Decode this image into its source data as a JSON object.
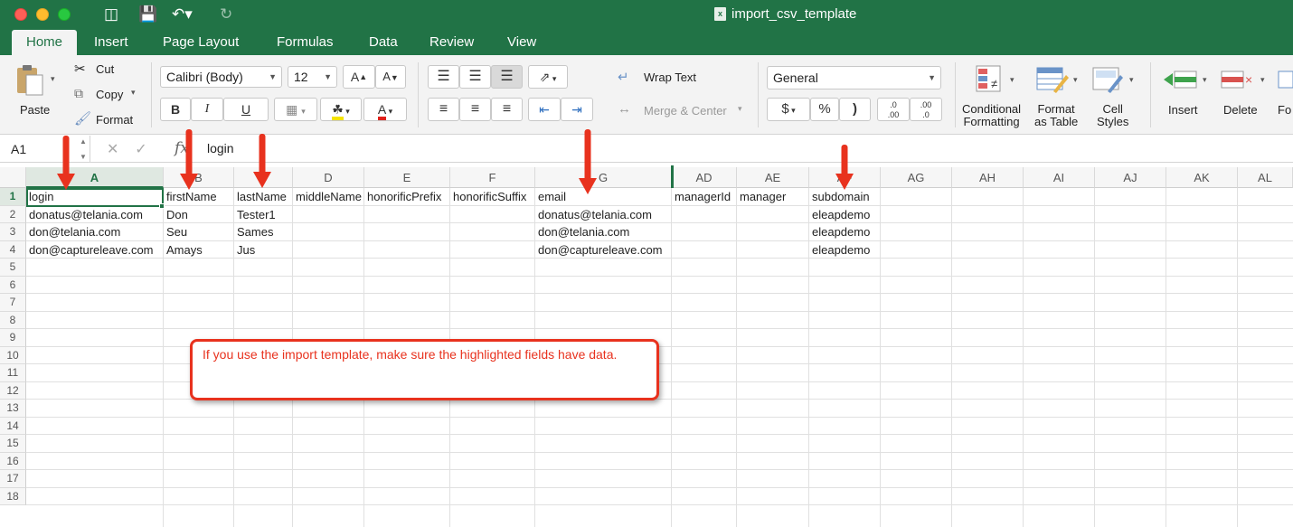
{
  "window": {
    "title": "import_csv_template"
  },
  "quick_access": {
    "icons": [
      "sidebar-icon",
      "save-icon",
      "undo-icon",
      "redo-icon"
    ]
  },
  "ribbon_tabs": [
    "Home",
    "Insert",
    "Page Layout",
    "Formulas",
    "Data",
    "Review",
    "View"
  ],
  "active_tab": "Home",
  "clipboard": {
    "paste": "Paste",
    "cut": "Cut",
    "copy": "Copy",
    "format": "Format"
  },
  "font": {
    "name": "Calibri (Body)",
    "size": "12",
    "bold": "B",
    "italic": "I",
    "underline": "U",
    "font_color_label": "A"
  },
  "alignment": {
    "wrap_text": "Wrap Text",
    "merge_center": "Merge & Center"
  },
  "number": {
    "format": "General",
    "currency": "$",
    "percent": "%",
    "comma": ")",
    "inc_decimal": ".0\n.00",
    "dec_decimal": ".00\n.0"
  },
  "styles": {
    "conditional_1": "Conditional",
    "conditional_2": "Formatting",
    "table_1": "Format",
    "table_2": "as Table",
    "cell_1": "Cell",
    "cell_2": "Styles"
  },
  "cells_group": {
    "insert": "Insert",
    "delete": "Delete",
    "format": "Fo"
  },
  "formula_bar": {
    "name_box": "A1",
    "fx": "fx",
    "value": "login"
  },
  "columns": [
    "A",
    "B",
    "C",
    "D",
    "E",
    "F",
    "G",
    "AD",
    "AE",
    "AF",
    "AG",
    "AH",
    "AI",
    "AJ",
    "AK",
    "AL"
  ],
  "row_numbers": [
    "1",
    "2",
    "3",
    "4",
    "5",
    "6",
    "7",
    "8",
    "9",
    "10",
    "11",
    "12",
    "13",
    "14",
    "15",
    "16",
    "17",
    "18"
  ],
  "rows": [
    [
      "login",
      "firstName",
      "lastName",
      "middleName",
      "honorificPrefix",
      "honorificSuffix",
      "email",
      "managerId",
      "manager",
      "subdomain"
    ],
    [
      "donatus@telania.com",
      "Don",
      "Tester1",
      "",
      "",
      "",
      "donatus@telania.com",
      "",
      "",
      "eleapdemo"
    ],
    [
      "don@telania.com",
      "Seu",
      "Sames",
      "",
      "",
      "",
      "don@telania.com",
      "",
      "",
      "eleapdemo"
    ],
    [
      "don@captureleave.com",
      "Amays",
      "Jus",
      "",
      "",
      "",
      "don@captureleave.com",
      "",
      "",
      "eleapdemo"
    ]
  ],
  "callout": "If you use the import template, make sure the highlighted fields have data.",
  "colors": {
    "excel_green": "#217346",
    "annotation_red": "#e8321e"
  }
}
